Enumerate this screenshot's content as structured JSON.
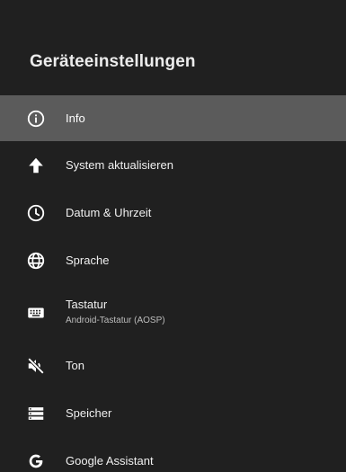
{
  "header": {
    "title": "Geräteeinstellungen"
  },
  "menu": {
    "items": [
      {
        "label": "Info",
        "icon": "info-icon",
        "selected": true
      },
      {
        "label": "System aktualisieren",
        "icon": "arrow-up-icon"
      },
      {
        "label": "Datum & Uhrzeit",
        "icon": "clock-icon"
      },
      {
        "label": "Sprache",
        "icon": "globe-icon"
      },
      {
        "label": "Tastatur",
        "sublabel": "Android-Tastatur (AOSP)",
        "icon": "keyboard-icon"
      },
      {
        "label": "Ton",
        "icon": "volume-off-icon"
      },
      {
        "label": "Speicher",
        "icon": "storage-icon"
      },
      {
        "label": "Google Assistant",
        "icon": "google-g-icon"
      }
    ]
  },
  "colors": {
    "background": "#202020",
    "selected_row": "#5b5b5b",
    "text": "#f0f0f0",
    "subtext": "#bdbdbd"
  }
}
